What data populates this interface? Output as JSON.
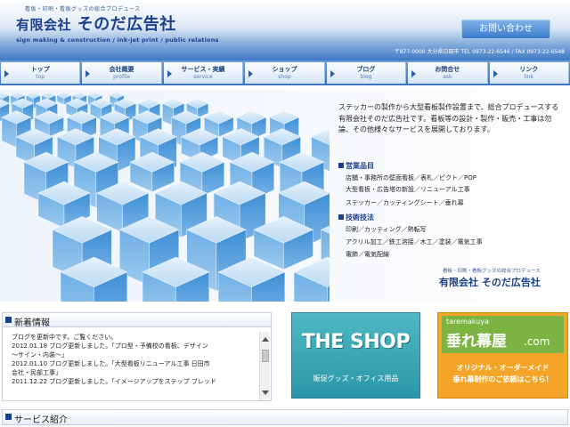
{
  "header": {
    "tagline": "看板・印刷・看板グッズの総合プロデュース",
    "logo_prefix": "有限会社",
    "logo_name": "そのだ広告社",
    "logo_sub": "sign making & construction / ink-jet print / public relations",
    "contact_button": "お問い合わせ",
    "address": "〒877-0000 大分県日田市 TEL 0973-22-6546 / FAX 0973-22-6548"
  },
  "nav": {
    "items": [
      {
        "jp": "トップ",
        "en": "top"
      },
      {
        "jp": "会社概要",
        "en": "profile"
      },
      {
        "jp": "サービス・実績",
        "en": "service"
      },
      {
        "jp": "ショップ",
        "en": "shop"
      },
      {
        "jp": "ブログ",
        "en": "blog"
      },
      {
        "jp": "お問合せ",
        "en": "ask"
      },
      {
        "jp": "リンク",
        "en": "link"
      }
    ]
  },
  "hero": {
    "intro": "ステッカーの製作から大型看板製作設置まで、総合プロデュースする有限会社そのだ広告社です。看板等の設計・製作・販売・工事は勿論、その他様々なサービスを展開しております。",
    "section1_title": "営業品目",
    "section1_lines": [
      "店舗・事務所の壁面看板／表札／ピクト／POP",
      "大型看板・広告塔の新設／リニューアル工事",
      "ステッカー／カッティングシート／垂れ幕"
    ],
    "section2_title": "技術技法",
    "section2_lines": [
      "印刷／カッティング／熱転写",
      "アクリル加工／鉄工溶接／木工／塗装／電気工事",
      "電飾／電気配線"
    ],
    "tagline": "看板・印刷・看板グッズの総合プロデュース",
    "logo": "有限会社 そのだ広告社"
  },
  "news": {
    "title": "新着情報",
    "rows": [
      "ブログを更新中です。ご覧ください。",
      "2012.01.18 ブログ更新しました。「プロ型・予備校の看板、デザイン",
      "〜サイン・内装〜」",
      "2012.01.10 ブログ更新しました。「大型看板リニューアル工事 日田市",
      "会社・民部工事」",
      "2011.12.22 ブログ更新しました。「イメージアップをステップ ブレッド"
    ]
  },
  "shop_banner": {
    "title": "THE SHOP",
    "subtitle": "販促グッズ・オフィス用品"
  },
  "taremaku_banner": {
    "en": "taremakuya",
    "name": "垂れ幕屋",
    "com": ".com",
    "desc1": "オリジナル・オーダーメイド",
    "desc2": "垂れ幕制作のご依頼はこちら！"
  },
  "service": {
    "title": "サービス紹介"
  },
  "colors": {
    "brand_blue": "#1a3f8c",
    "shop_teal": "#2a97a8",
    "tm_orange": "#f4a528",
    "tm_green": "#7cb342"
  }
}
